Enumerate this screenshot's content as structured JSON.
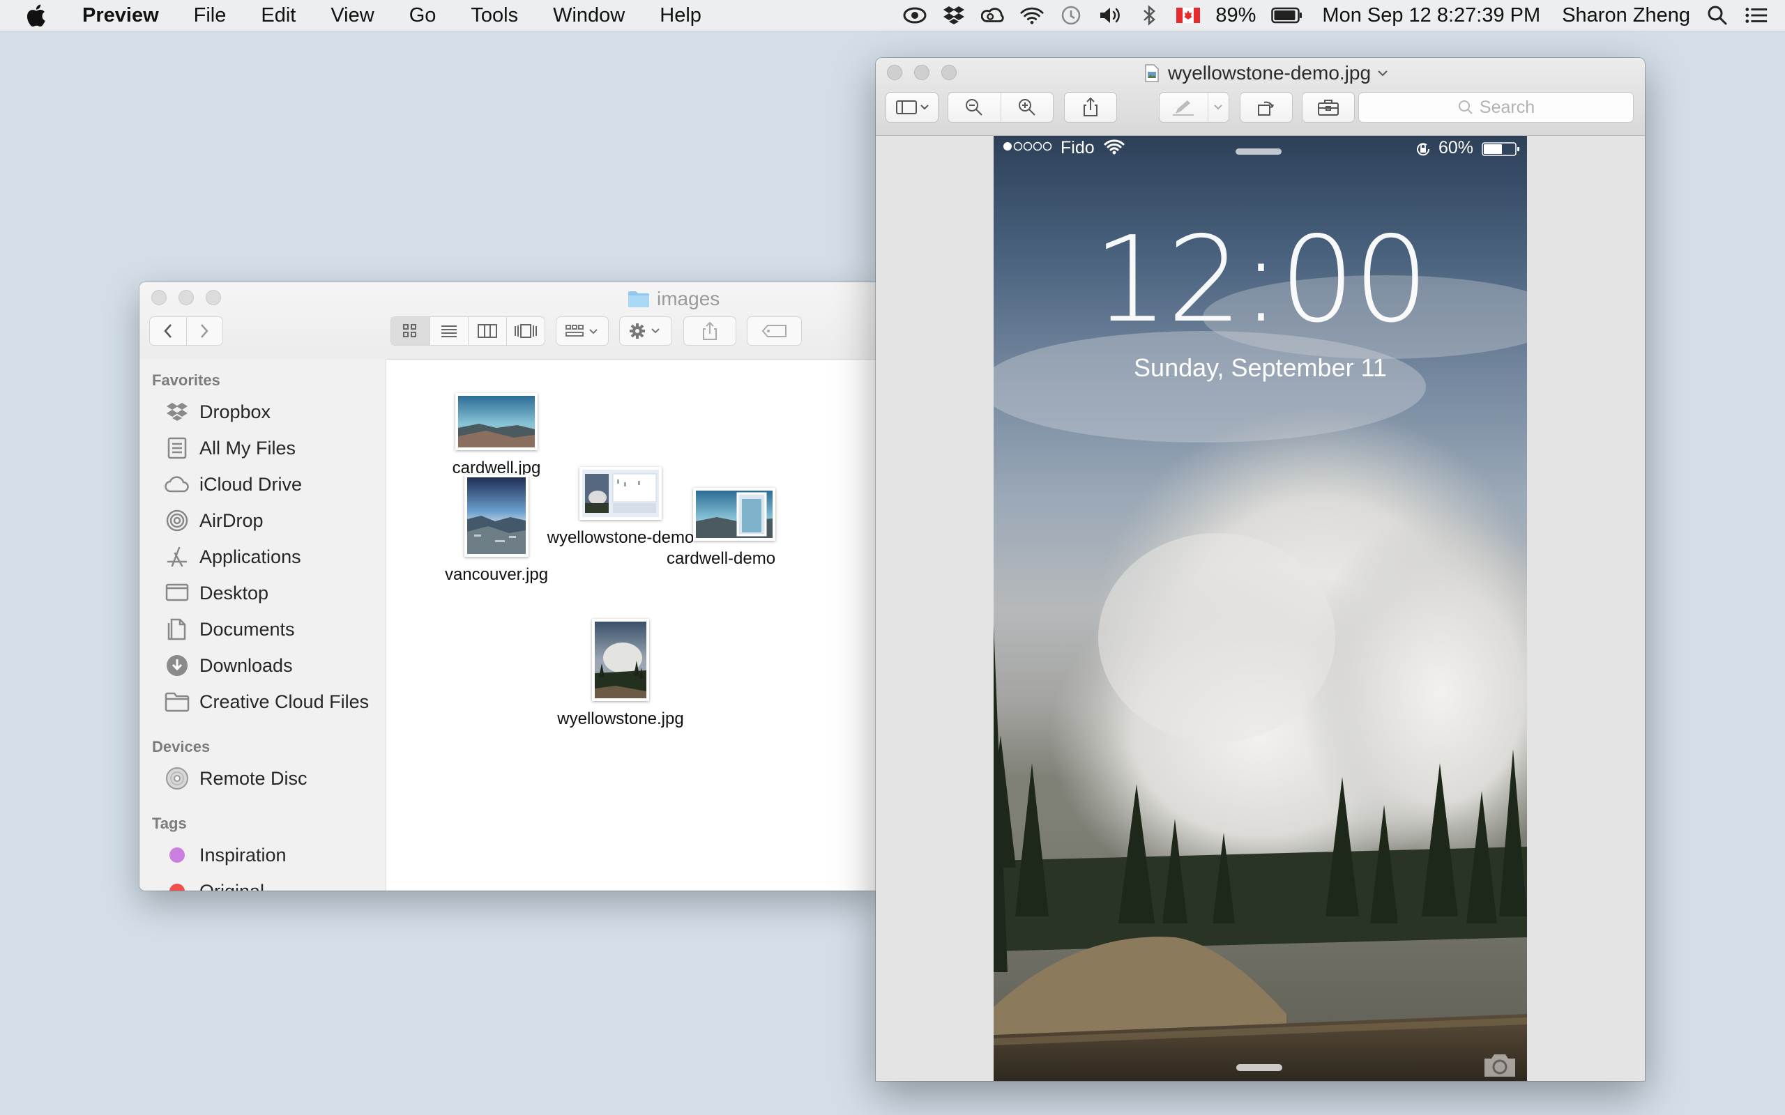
{
  "menubar": {
    "app_name": "Preview",
    "menus": [
      "File",
      "Edit",
      "View",
      "Go",
      "Tools",
      "Window",
      "Help"
    ],
    "battery": "89%",
    "datetime": "Mon Sep 12  8:27:39 PM",
    "user": "Sharon Zheng"
  },
  "finder": {
    "title": "images",
    "sidebar": {
      "favorites_header": "Favorites",
      "favorites": [
        {
          "label": "Dropbox",
          "icon": "dropbox-icon"
        },
        {
          "label": "All My Files",
          "icon": "all-files-icon"
        },
        {
          "label": "iCloud Drive",
          "icon": "cloud-icon"
        },
        {
          "label": "AirDrop",
          "icon": "airdrop-icon"
        },
        {
          "label": "Applications",
          "icon": "applications-icon"
        },
        {
          "label": "Desktop",
          "icon": "desktop-icon"
        },
        {
          "label": "Documents",
          "icon": "documents-icon"
        },
        {
          "label": "Downloads",
          "icon": "downloads-icon"
        },
        {
          "label": "Creative Cloud Files",
          "icon": "folder-icon"
        }
      ],
      "devices_header": "Devices",
      "devices": [
        {
          "label": "Remote Disc",
          "icon": "disc-icon"
        }
      ],
      "tags_header": "Tags",
      "tags": [
        {
          "label": "Inspiration",
          "color": "#c97ee0"
        },
        {
          "label": "Original",
          "color": "#f0504a"
        }
      ]
    },
    "files": [
      {
        "name": "cardwell.jpg"
      },
      {
        "name": "wyellowstone-demo"
      },
      {
        "name": "vancouver.jpg"
      },
      {
        "name": "cardwell-demo"
      },
      {
        "name": "wyellowstone.jpg"
      }
    ]
  },
  "preview": {
    "title": "wyellowstone-demo.jpg",
    "search_placeholder": "Search",
    "phone": {
      "carrier": "Fido",
      "battery": "60%",
      "time": "12:00",
      "date": "Sunday, September 11"
    }
  },
  "colors": {
    "desktop": "#d3dee8",
    "tag_inspiration": "#c97ee0",
    "tag_original": "#f0504a"
  }
}
